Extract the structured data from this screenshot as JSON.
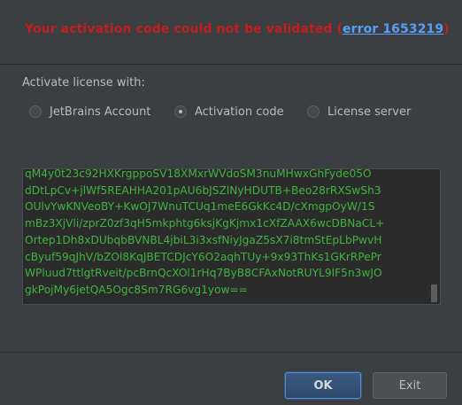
{
  "error": {
    "message": "Your activation code could not be validated (",
    "link_text": "error 1653219",
    "suffix": ")"
  },
  "activate_with_label": "Activate license with:",
  "options": [
    {
      "label": "JetBrains Account",
      "selected": false
    },
    {
      "label": "Activation code",
      "selected": true
    },
    {
      "label": "License server",
      "selected": false
    }
  ],
  "activation_code_lines": [
    "qM4y0t23c92HXKrgppoSV18XMxrWVdoSM3nuMHwxGhFyde05O",
    "dDtLpCv+jlWf5REAHHA201pAU6bJSZlNyHDUTB+Beo28rRXSwSh3",
    "OUlvYwKNVeoBY+KwOJ7WnuTCUq1meE6GkKc4D/cXmgpOyW/1S",
    "mBz3XjVli/zprZ0zf3qH5mkphtg6ksjKgKjmx1cXfZAAX6wcDBNaCL+",
    "Ortep1Dh8xDUbqbBVNBL4jbiL3i3xsfNiyJgaZ5sX7i8tmStEpLbPwvH",
    "cByuf59qJhV/bZOl8KqJBETCDJcY6O2aqhTUy+9x93ThKs1GKrRPePr",
    "WPluud7ttlgtRveit/pcBrnQcXOl1rHq7ByB8CFAxNotRUYL9IF5n3wJO",
    "gkPojMy6jetQA5Ogc8Sm7RG6vg1yow=="
  ],
  "buttons": {
    "ok_label": "OK",
    "exit_label": "Exit"
  },
  "colors": {
    "error_red": "#c61e1e",
    "link_blue": "#589df6",
    "code_green": "#3fb43f",
    "background": "#3c3f41"
  }
}
